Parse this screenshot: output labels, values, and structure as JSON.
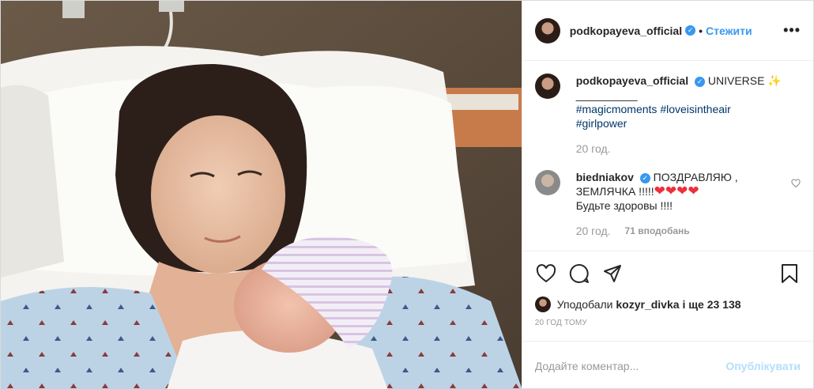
{
  "post": {
    "username": "podkopayeva_official",
    "follow_label": "Стежити",
    "more_label": "•••"
  },
  "caption": {
    "username": "podkopayeva_official",
    "text": "UNIVERSE ✨",
    "divider": "__________",
    "hashtags": [
      "#magicmoments",
      "#loveisintheair",
      "#girlpower"
    ],
    "time": "20 год."
  },
  "comment": {
    "username": "biedniakov",
    "text_line1": "ПОЗДРАВЛЯЮ ,",
    "text_line2": "ЗЕМЛЯЧКА !!!!!",
    "hearts": "❤❤❤❤",
    "text_line3": "Будьте здоровы !!!!",
    "time": "20 год.",
    "likes": "71 вподобань"
  },
  "likes": {
    "prefix": "Уподобали",
    "user": "kozyr_divka",
    "suffix": "і ще 23 138"
  },
  "posted_time": "20 ГОД ТОМУ",
  "composer": {
    "placeholder": "Додайте коментар...",
    "publish_label": "Опублікувати"
  },
  "colors": {
    "accent": "#3897f0",
    "hashtag": "#003569",
    "heart": "#ed2f3c",
    "muted": "#999999",
    "publish_disabled": "#b2dffc"
  }
}
